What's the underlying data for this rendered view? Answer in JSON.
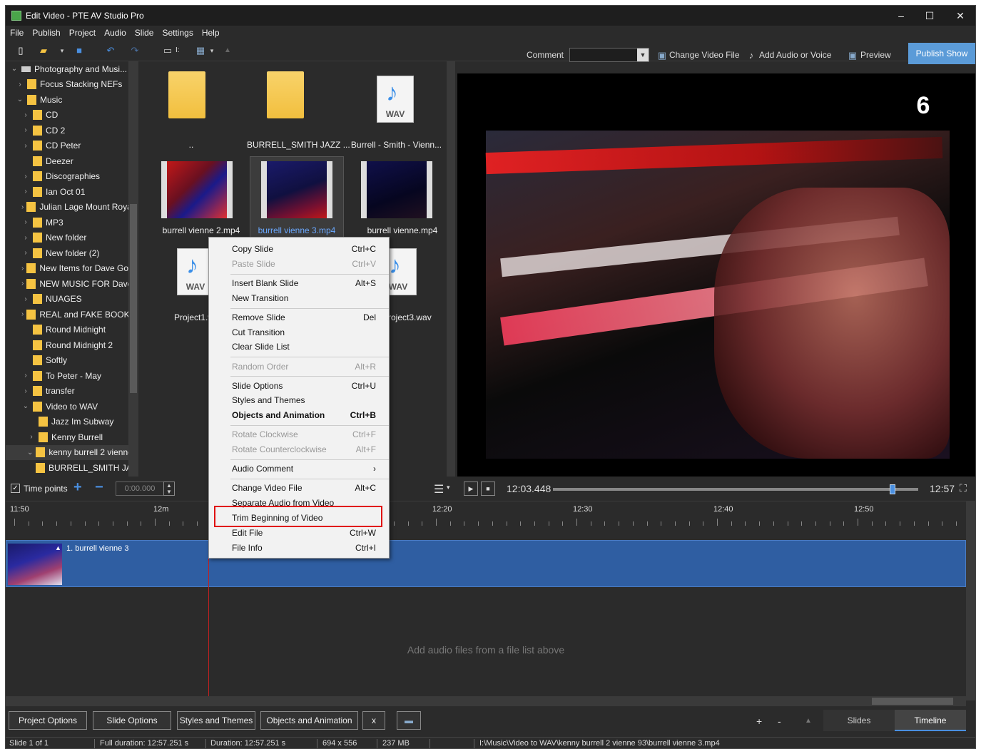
{
  "window": {
    "title": "Edit Video - PTE AV Studio Pro",
    "min": "–",
    "max": "☐",
    "close": "✕"
  },
  "menu": [
    "File",
    "Publish",
    "Project",
    "Audio",
    "Slide",
    "Settings",
    "Help"
  ],
  "toolbar": {
    "comment_label": "Comment",
    "comment_value": "",
    "change_video": "Change Video File",
    "add_audio": "Add Audio or Voice",
    "preview": "Preview",
    "publish": "Publish Show",
    "drive_label": "I:"
  },
  "tree": [
    {
      "label": "Photography and Musi...",
      "chev": "v",
      "indent": 0,
      "icon": "drive"
    },
    {
      "label": "Focus Stacking NEFs",
      "chev": ">",
      "indent": 1
    },
    {
      "label": "Music",
      "chev": "v",
      "indent": 1
    },
    {
      "label": "CD",
      "chev": ">",
      "indent": 2
    },
    {
      "label": "CD 2",
      "chev": ">",
      "indent": 2
    },
    {
      "label": "CD Peter",
      "chev": ">",
      "indent": 2
    },
    {
      "label": "Deezer",
      "chev": "",
      "indent": 2
    },
    {
      "label": "Discographies",
      "chev": ">",
      "indent": 2
    },
    {
      "label": "Ian Oct 01",
      "chev": ">",
      "indent": 2
    },
    {
      "label": "Julian Lage Mount Roya",
      "chev": ">",
      "indent": 2
    },
    {
      "label": "MP3",
      "chev": ">",
      "indent": 2
    },
    {
      "label": "New folder",
      "chev": ">",
      "indent": 2
    },
    {
      "label": "New folder (2)",
      "chev": ">",
      "indent": 2
    },
    {
      "label": "New Items for Dave Goo",
      "chev": ">",
      "indent": 2
    },
    {
      "label": "NEW MUSIC FOR Dave I",
      "chev": ">",
      "indent": 2
    },
    {
      "label": "NUAGES",
      "chev": ">",
      "indent": 2
    },
    {
      "label": "REAL and FAKE BOOKS",
      "chev": ">",
      "indent": 2
    },
    {
      "label": "Round Midnight",
      "chev": "",
      "indent": 2
    },
    {
      "label": "Round Midnight 2",
      "chev": "",
      "indent": 2
    },
    {
      "label": "Softly",
      "chev": "",
      "indent": 2
    },
    {
      "label": "To Peter - May",
      "chev": ">",
      "indent": 2
    },
    {
      "label": "transfer",
      "chev": ">",
      "indent": 2
    },
    {
      "label": "Video to WAV",
      "chev": "v",
      "indent": 2
    },
    {
      "label": "Jazz Im Subway",
      "chev": "",
      "indent": 3
    },
    {
      "label": "Kenny Burrell",
      "chev": ">",
      "indent": 3
    },
    {
      "label": "kenny burrell 2 vienne",
      "chev": "v",
      "indent": 3,
      "selected": true
    },
    {
      "label": "BURRELL_SMITH JAZ",
      "chev": "",
      "indent": 4
    }
  ],
  "files": {
    "up": "..",
    "folder1": "BURRELL_SMITH JAZZ ...",
    "wav1": "Burrell - Smith - Vienn...",
    "vid1": "burrell vienne 2.mp4",
    "vid2": "burrell vienne 3.mp4",
    "vid3": "burrell vienne.mp4",
    "wav2": "Project1.wav",
    "wav3": "Project3.wav",
    "wav_label": "WAV"
  },
  "context_menu": [
    {
      "label": "Copy Slide",
      "key": "Ctrl+C"
    },
    {
      "label": "Paste Slide",
      "key": "Ctrl+V",
      "disabled": true
    },
    {
      "label": "Insert Blank Slide",
      "key": "Alt+S"
    },
    {
      "label": "New Transition",
      "key": ""
    },
    {
      "label": "Remove Slide",
      "key": "Del"
    },
    {
      "label": "Cut Transition",
      "key": ""
    },
    {
      "label": "Clear Slide List",
      "key": ""
    },
    {
      "label": "Random Order",
      "key": "Alt+R",
      "disabled": true
    },
    {
      "label": "Slide Options",
      "key": "Ctrl+U"
    },
    {
      "label": "Styles and Themes",
      "key": ""
    },
    {
      "label": "Objects and Animation",
      "key": "Ctrl+B",
      "bold": true
    },
    {
      "label": "Rotate Clockwise",
      "key": "Ctrl+F",
      "disabled": true
    },
    {
      "label": "Rotate Counterclockwise",
      "key": "Alt+F",
      "disabled": true
    },
    {
      "label": "Audio Comment",
      "key": "›"
    },
    {
      "label": "Change Video File",
      "key": "Alt+C"
    },
    {
      "label": "Separate Audio from Video",
      "key": ""
    },
    {
      "label": "Trim Beginning of Video",
      "key": ""
    },
    {
      "label": "Edit File",
      "key": "Ctrl+W"
    },
    {
      "label": "File Info",
      "key": "Ctrl+I"
    }
  ],
  "timeline_controls": {
    "time_points": "Time points",
    "time_points_checked": true,
    "time_value": "0:00.000",
    "current_time": "12:03.448",
    "end_time": "12:57",
    "playhead_position_fraction": 0.93
  },
  "ruler": [
    "11:50",
    "12m",
    "12:20",
    "12:30",
    "12:40",
    "12:50"
  ],
  "track": {
    "clip_label": "1. burrell vienne 3"
  },
  "audio_hint": "Add audio files from a file list above",
  "bottom_buttons": [
    "Project Options",
    "Slide Options",
    "Styles and Themes",
    "Objects and Animation",
    "x"
  ],
  "bottom_tabs": {
    "slides": "Slides",
    "timeline": "Timeline"
  },
  "status": {
    "slide": "Slide 1 of 1",
    "full_duration": "Full duration: 12:57.251 s",
    "duration": "Duration: 12:57.251 s",
    "dims": "694 x 556",
    "size": "237 MB",
    "path": "I:\\Music\\Video to WAV\\kenny burrell 2 vienne 93\\burrell vienne 3.mp4"
  },
  "colors": {
    "accent": "#5b9bd8",
    "track": "#2f5ea2",
    "highlight": "#e01010",
    "folder": "#f5c342"
  }
}
